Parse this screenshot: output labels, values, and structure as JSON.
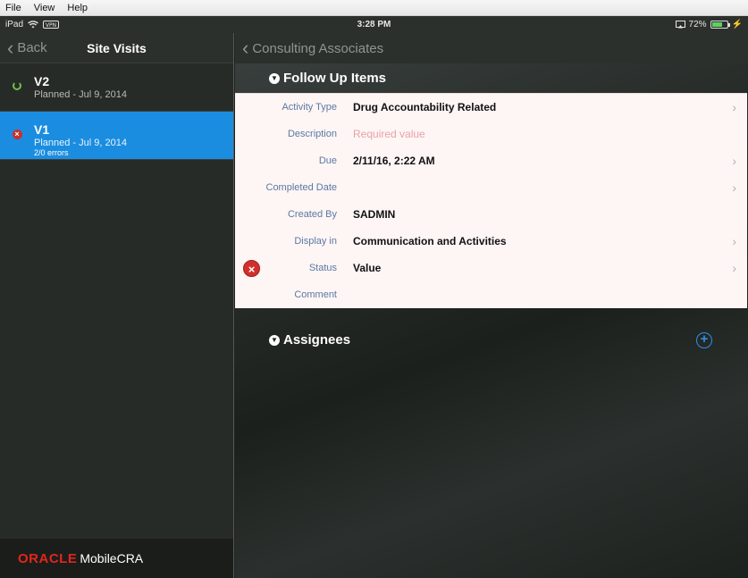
{
  "menubar": {
    "items": [
      "File",
      "View",
      "Help"
    ]
  },
  "status": {
    "device": "iPad",
    "time": "3:28 PM",
    "battery": "72%",
    "battery_level": 0.72
  },
  "left": {
    "back_label": "Back",
    "title": "Site Visits",
    "visits": [
      {
        "name": "V2",
        "sub": "Planned - Jul 9, 2014",
        "errors": ""
      },
      {
        "name": "V1",
        "sub": "Planned - Jul 9, 2014",
        "errors": "2/0 errors"
      }
    ],
    "footer": {
      "brand": "ORACLE",
      "product": "MobileCRA"
    }
  },
  "right": {
    "back_label": "Consulting Associates",
    "section_followup": "Follow Up Items",
    "fields": [
      {
        "label": "Activity Type",
        "value": "Drug Accountability Related"
      },
      {
        "label": "Description",
        "value": "",
        "placeholder": "Required value"
      },
      {
        "label": "Due",
        "value": "2/11/16, 2:22 AM"
      },
      {
        "label": "Completed Date",
        "value": ""
      },
      {
        "label": "Created By",
        "value": "SADMIN"
      },
      {
        "label": "Display in",
        "value": "Communication and Activities"
      },
      {
        "label": "Status",
        "value": "Value"
      },
      {
        "label": "Comment",
        "value": ""
      }
    ],
    "section_assignees": "Assignees"
  },
  "colors": {
    "selection": "#1a8de0",
    "error": "#d0302b",
    "brand": "#e1261c",
    "label": "#5b79a3"
  }
}
